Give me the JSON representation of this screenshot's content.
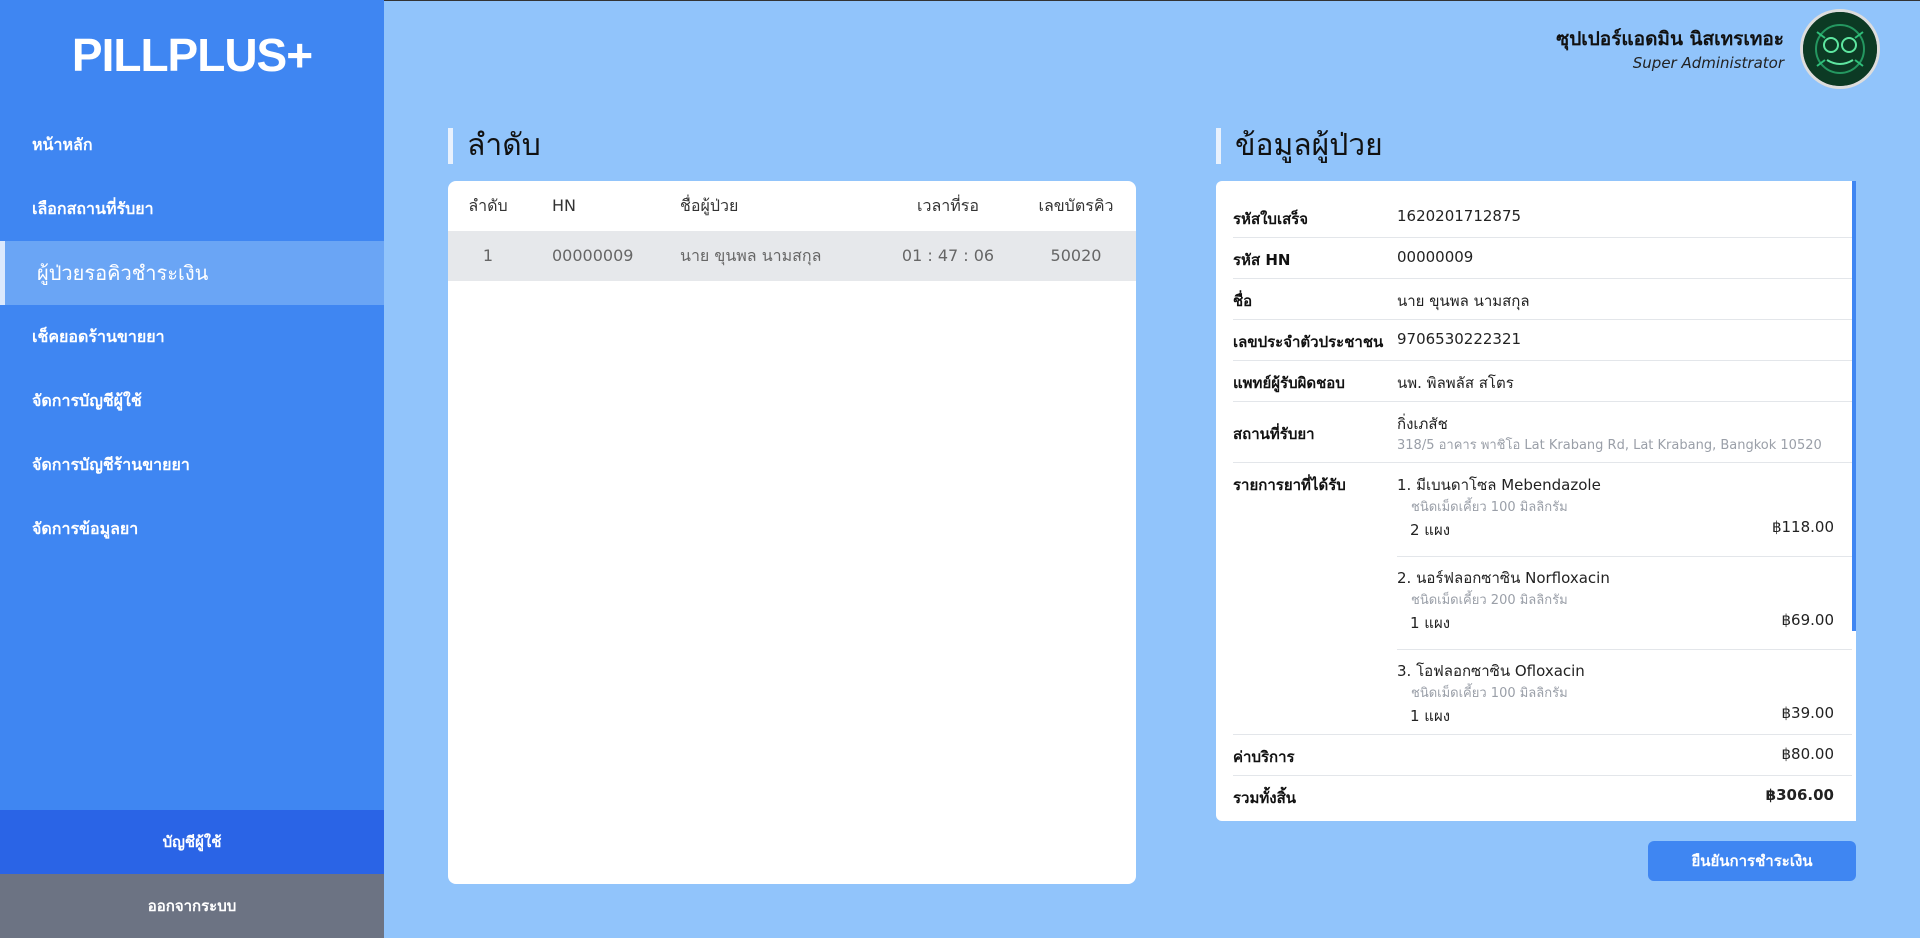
{
  "app": {
    "logo": "PILLPLUS+"
  },
  "sidebar": {
    "items": [
      {
        "label": "หน้าหลัก"
      },
      {
        "label": "เลือกสถานที่รับยา"
      },
      {
        "label": "ผู้ป่วยรอคิวชำระเงิน"
      },
      {
        "label": "เช็คยอดร้านขายยา"
      },
      {
        "label": "จัดการบัญชีผู้ใช้"
      },
      {
        "label": "จัดการบัญชีร้านขายยา"
      },
      {
        "label": "จัดการข้อมูลยา"
      }
    ],
    "active_index": 2,
    "account_label": "บัญชีผู้ใช้",
    "logout_label": "ออกจากระบบ"
  },
  "user": {
    "name": "ซุปเปอร์แอดมิน นิสเทรเทอะ",
    "role": "Super Administrator"
  },
  "queue": {
    "title": "ลำดับ",
    "columns": {
      "order": "ลำดับ",
      "hn": "HN",
      "name": "ชื่อผู้ป่วย",
      "wait": "เวลาที่รอ",
      "ticket": "เลขบัตรคิว"
    },
    "rows": [
      {
        "order": "1",
        "hn": "00000009",
        "name": "นาย ขุนพล นามสกุล",
        "wait": "01 : 47 : 06",
        "ticket": "50020"
      }
    ]
  },
  "patient": {
    "title": "ข้อมูลผู้ป่วย",
    "receipt_label": "รหัสใบเสร็จ",
    "receipt_value": "1620201712875",
    "hn_label": "รหัส HN",
    "hn_value": "00000009",
    "name_label": "ชื่อ",
    "name_value": "นาย ขุนพล นามสกุล",
    "id_label": "เลขประจำตัวประชาชน",
    "id_value": "9706530222321",
    "doctor_label": "แพทย์ผู้รับผิดชอบ",
    "doctor_value": "นพ. พิลพลัส สโตร",
    "pickup_label": "สถานที่รับยา",
    "pickup_name": "กิ่งเภสัช",
    "pickup_address": "318/5 อาคาร พาชิโอ Lat Krabang Rd, Lat Krabang, Bangkok 10520",
    "meds_label": "รายการยาที่ได้รับ",
    "meds": [
      {
        "name": "1. มีเบนดาโซล Mebendazole",
        "detail": "ชนิดเม็ดเคี้ยว 100 มิลลิกรัม",
        "qty": "2 แผง",
        "price": "฿118.00"
      },
      {
        "name": "2. นอร์ฟลอกซาซิน Norfloxacin",
        "detail": "ชนิดเม็ดเคี้ยว 200 มิลลิกรัม",
        "qty": "1 แผง",
        "price": "฿69.00"
      },
      {
        "name": "3. โอฟลอกซาซิน Ofloxacin",
        "detail": "ชนิดเม็ดเคี้ยว 100 มิลลิกรัม",
        "qty": "1 แผง",
        "price": "฿39.00"
      }
    ],
    "service_label": "ค่าบริการ",
    "service_value": "฿80.00",
    "total_label": "รวมทั้งสิ้น",
    "total_value": "฿306.00"
  },
  "confirm_label": "ยืนยันการชำระเงิน"
}
